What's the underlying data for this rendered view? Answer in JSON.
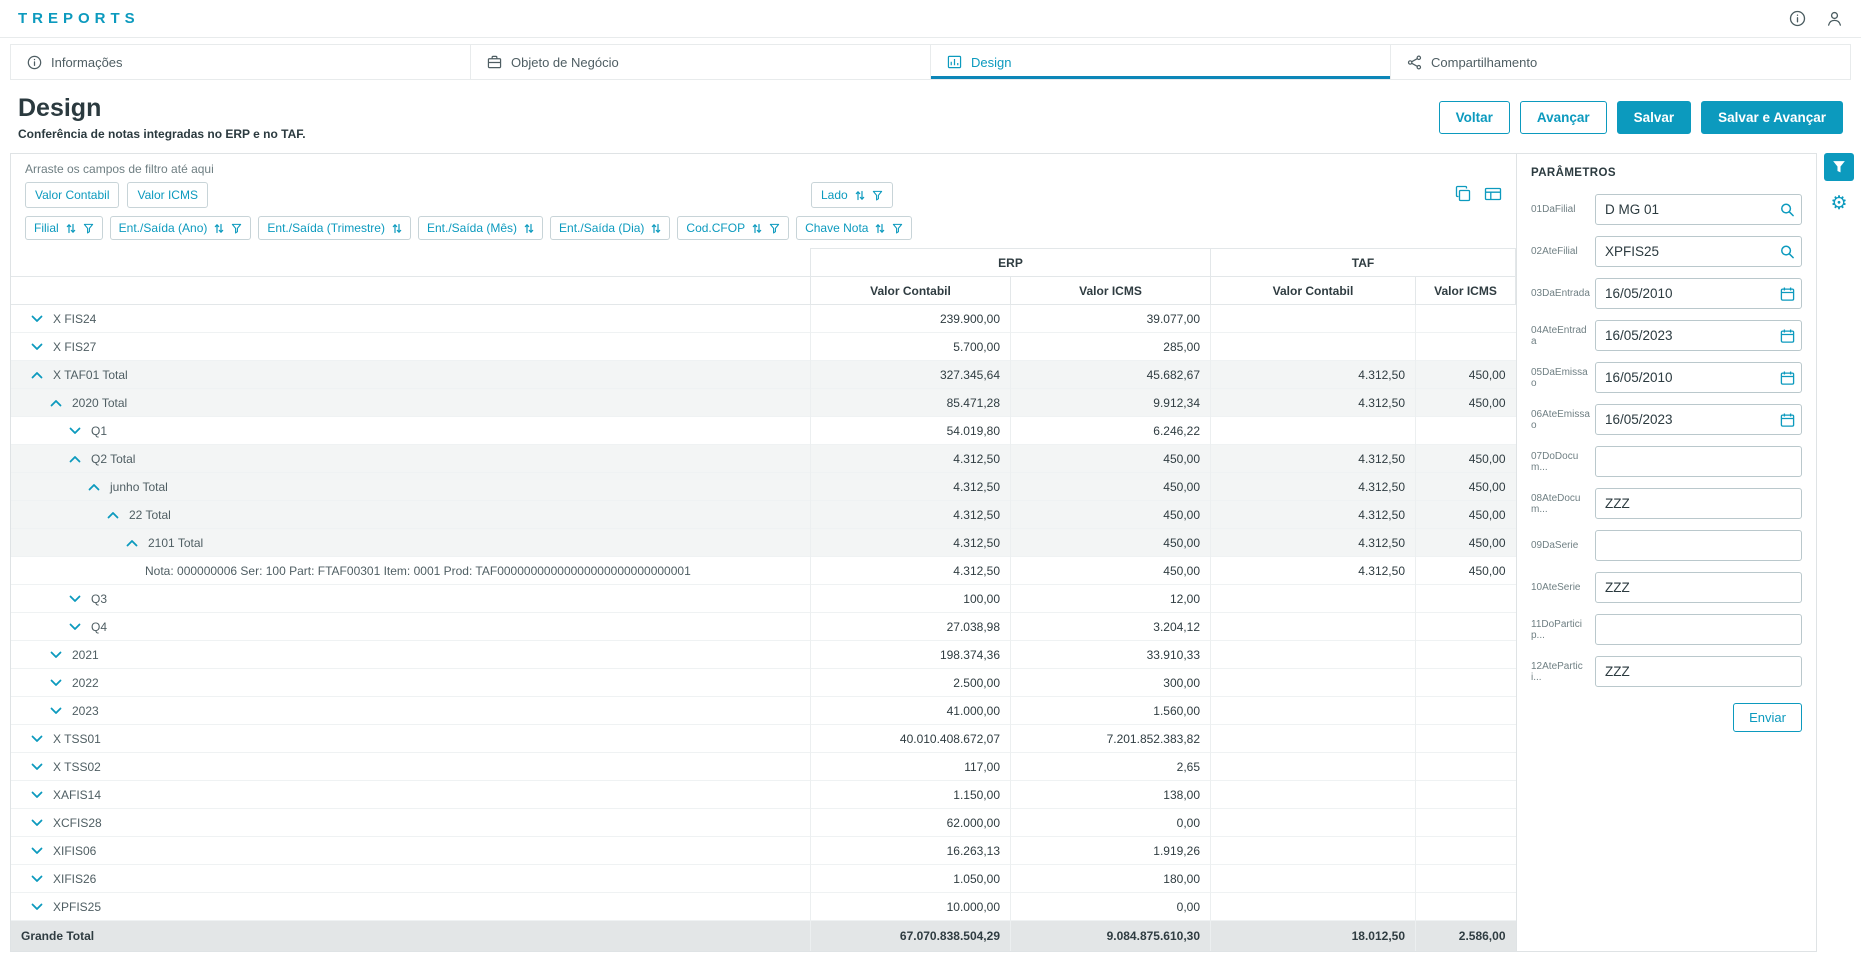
{
  "app": {
    "title": "TREPORTS"
  },
  "colors": {
    "accent": "#0c9abe",
    "tab_underline": "#0c86b8",
    "row_highlight": "#f3f5f5",
    "grand_total_bg": "#e3e6e7"
  },
  "tabs": [
    {
      "label": "Informações",
      "icon": "info-icon",
      "selected": false
    },
    {
      "label": "Objeto de Negócio",
      "icon": "business-object-icon",
      "selected": false
    },
    {
      "label": "Design",
      "icon": "design-icon",
      "selected": true
    },
    {
      "label": "Compartilhamento",
      "icon": "share-icon",
      "selected": false
    }
  ],
  "page": {
    "title": "Design",
    "subtitle": "Conferência de notas integradas no ERP e no TAF.",
    "actions": [
      {
        "label": "Voltar",
        "style": "outline"
      },
      {
        "label": "Avançar",
        "style": "outline"
      },
      {
        "label": "Salvar",
        "style": "solid"
      },
      {
        "label": "Salvar e Avançar",
        "style": "solid"
      }
    ]
  },
  "pivot": {
    "filter_drop_hint": "Arraste os campos de filtro até aqui",
    "value_chips": [
      {
        "label": "Valor Contabil"
      },
      {
        "label": "Valor ICMS"
      }
    ],
    "column_chip": {
      "label": "Lado",
      "sort": true,
      "filter": true
    },
    "row_chips": [
      {
        "label": "Filial",
        "sort": true,
        "filter": true
      },
      {
        "label": "Ent./Saída (Ano)",
        "sort": true,
        "filter": true
      },
      {
        "label": "Ent./Saída (Trimestre)",
        "sort": true,
        "filter": false
      },
      {
        "label": "Ent./Saída (Mês)",
        "sort": true,
        "filter": false
      },
      {
        "label": "Ent./Saída (Dia)",
        "sort": true,
        "filter": false
      },
      {
        "label": "Cod.CFOP",
        "sort": true,
        "filter": true
      },
      {
        "label": "Chave Nota",
        "sort": true,
        "filter": true
      }
    ],
    "toolbar_icons": [
      "copy-icon",
      "export-icon"
    ],
    "table": {
      "groups": [
        "ERP",
        "TAF"
      ],
      "subheaders": [
        "Valor Contabil",
        "Valor ICMS",
        "Valor Contabil",
        "Valor ICMS"
      ],
      "rows": [
        {
          "label": "X FIS24",
          "level": 0,
          "chevron": true,
          "expanded": false,
          "highlight": false,
          "values": [
            "239.900,00",
            "39.077,00",
            "",
            ""
          ]
        },
        {
          "label": "X FIS27",
          "level": 0,
          "chevron": true,
          "expanded": false,
          "highlight": false,
          "values": [
            "5.700,00",
            "285,00",
            "",
            ""
          ]
        },
        {
          "label": "X TAF01 Total",
          "level": 0,
          "chevron": true,
          "expanded": true,
          "highlight": true,
          "values": [
            "327.345,64",
            "45.682,67",
            "4.312,50",
            "450,00"
          ]
        },
        {
          "label": "2020 Total",
          "level": 1,
          "chevron": true,
          "expanded": true,
          "highlight": true,
          "values": [
            "85.471,28",
            "9.912,34",
            "4.312,50",
            "450,00"
          ]
        },
        {
          "label": "Q1",
          "level": 2,
          "chevron": true,
          "expanded": false,
          "highlight": false,
          "values": [
            "54.019,80",
            "6.246,22",
            "",
            ""
          ]
        },
        {
          "label": "Q2 Total",
          "level": 2,
          "chevron": true,
          "expanded": true,
          "highlight": true,
          "values": [
            "4.312,50",
            "450,00",
            "4.312,50",
            "450,00"
          ]
        },
        {
          "label": "junho Total",
          "level": 3,
          "chevron": true,
          "expanded": true,
          "highlight": true,
          "values": [
            "4.312,50",
            "450,00",
            "4.312,50",
            "450,00"
          ]
        },
        {
          "label": "22 Total",
          "level": 4,
          "chevron": true,
          "expanded": true,
          "highlight": true,
          "values": [
            "4.312,50",
            "450,00",
            "4.312,50",
            "450,00"
          ]
        },
        {
          "label": "2101 Total",
          "level": 5,
          "chevron": true,
          "expanded": true,
          "highlight": true,
          "values": [
            "4.312,50",
            "450,00",
            "4.312,50",
            "450,00"
          ]
        },
        {
          "label": "Nota: 000000006 Ser: 100 Part: FTAF00301 Item: 0001 Prod: TAF00000000000000000000000000001",
          "level": 6,
          "chevron": false,
          "expanded": false,
          "highlight": false,
          "values": [
            "4.312,50",
            "450,00",
            "4.312,50",
            "450,00"
          ]
        },
        {
          "label": "Q3",
          "level": 2,
          "chevron": true,
          "expanded": false,
          "highlight": false,
          "values": [
            "100,00",
            "12,00",
            "",
            ""
          ]
        },
        {
          "label": "Q4",
          "level": 2,
          "chevron": true,
          "expanded": false,
          "highlight": false,
          "values": [
            "27.038,98",
            "3.204,12",
            "",
            ""
          ]
        },
        {
          "label": "2021",
          "level": 1,
          "chevron": true,
          "expanded": false,
          "highlight": false,
          "values": [
            "198.374,36",
            "33.910,33",
            "",
            ""
          ]
        },
        {
          "label": "2022",
          "level": 1,
          "chevron": true,
          "expanded": false,
          "highlight": false,
          "values": [
            "2.500,00",
            "300,00",
            "",
            ""
          ]
        },
        {
          "label": "2023",
          "level": 1,
          "chevron": true,
          "expanded": false,
          "highlight": false,
          "values": [
            "41.000,00",
            "1.560,00",
            "",
            ""
          ]
        },
        {
          "label": "X TSS01",
          "level": 0,
          "chevron": true,
          "expanded": false,
          "highlight": false,
          "values": [
            "40.010.408.672,07",
            "7.201.852.383,82",
            "",
            ""
          ]
        },
        {
          "label": "X TSS02",
          "level": 0,
          "chevron": true,
          "expanded": false,
          "highlight": false,
          "values": [
            "117,00",
            "2,65",
            "",
            ""
          ]
        },
        {
          "label": "XAFIS14",
          "level": 0,
          "chevron": true,
          "expanded": false,
          "highlight": false,
          "values": [
            "1.150,00",
            "138,00",
            "",
            ""
          ]
        },
        {
          "label": "XCFIS28",
          "level": 0,
          "chevron": true,
          "expanded": false,
          "highlight": false,
          "values": [
            "62.000,00",
            "0,00",
            "",
            ""
          ]
        },
        {
          "label": "XIFIS06",
          "level": 0,
          "chevron": true,
          "expanded": false,
          "highlight": false,
          "values": [
            "16.263,13",
            "1.919,26",
            "",
            ""
          ]
        },
        {
          "label": "XIFIS26",
          "level": 0,
          "chevron": true,
          "expanded": false,
          "highlight": false,
          "values": [
            "1.050,00",
            "180,00",
            "",
            ""
          ]
        },
        {
          "label": "XPFIS25",
          "level": 0,
          "chevron": true,
          "expanded": false,
          "highlight": false,
          "values": [
            "10.000,00",
            "0,00",
            "",
            ""
          ]
        }
      ],
      "grand_total": {
        "label": "Grande Total",
        "values": [
          "67.070.838.504,29",
          "9.084.875.610,30",
          "18.012,50",
          "2.586,00"
        ]
      }
    }
  },
  "parameters": {
    "title": "PARÂMETROS",
    "fields": [
      {
        "label": "01DaFilial",
        "value": "D MG 01",
        "icon": "search"
      },
      {
        "label": "02AteFilial",
        "value": "XPFIS25",
        "icon": "search"
      },
      {
        "label": "03DaEntrada",
        "value": "16/05/2010",
        "icon": "calendar"
      },
      {
        "label": "04AteEntrada",
        "value": "16/05/2023",
        "icon": "calendar"
      },
      {
        "label": "05DaEmissao",
        "value": "16/05/2010",
        "icon": "calendar"
      },
      {
        "label": "06AteEmissao",
        "value": "16/05/2023",
        "icon": "calendar"
      },
      {
        "label": "07DoDocum...",
        "value": "",
        "icon": ""
      },
      {
        "label": "08AteDocum...",
        "value": "ZZZ",
        "icon": ""
      },
      {
        "label": "09DaSerie",
        "value": "",
        "icon": ""
      },
      {
        "label": "10AteSerie",
        "value": "ZZZ",
        "icon": ""
      },
      {
        "label": "11DoParticip...",
        "value": "",
        "icon": ""
      },
      {
        "label": "12AtePartici...",
        "value": "ZZZ",
        "icon": ""
      }
    ],
    "submit_label": "Enviar"
  },
  "side_toolbar": [
    "filter-icon",
    "gear-icon"
  ]
}
